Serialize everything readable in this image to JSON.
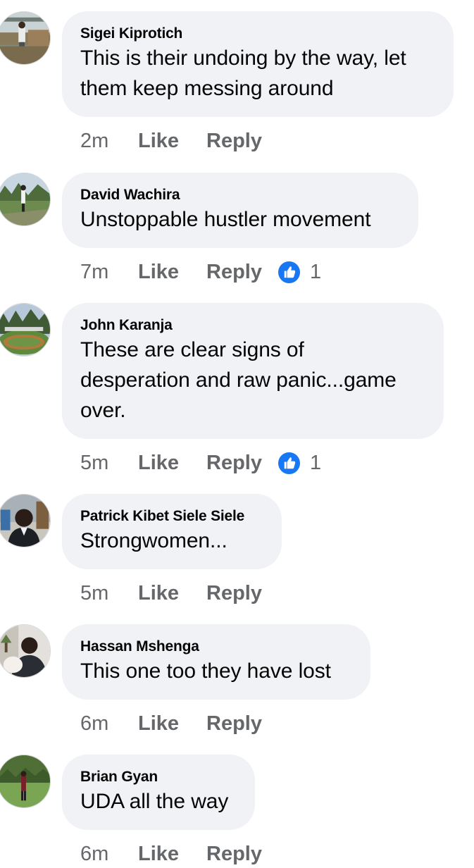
{
  "comments": [
    {
      "author": "Sigei Kiprotich",
      "lines": [
        "This is their undoing by the way, let",
        "them keep messing around"
      ],
      "time": "2m",
      "like_label": "Like",
      "reply_label": "Reply",
      "reactions": null
    },
    {
      "author": "David Wachira",
      "lines": [
        "Unstoppable hustler movement"
      ],
      "time": "7m",
      "like_label": "Like",
      "reply_label": "Reply",
      "reactions": "1"
    },
    {
      "author": "John Karanja",
      "lines": [
        "These are clear signs of",
        "desperation and raw panic...game",
        "over."
      ],
      "time": "5m",
      "like_label": "Like",
      "reply_label": "Reply",
      "reactions": "1"
    },
    {
      "author": "Patrick Kibet Siele Siele",
      "lines": [
        "Strongwomen..."
      ],
      "time": "5m",
      "like_label": "Like",
      "reply_label": "Reply",
      "reactions": null
    },
    {
      "author": "Hassan Mshenga",
      "lines": [
        "This one too they have lost"
      ],
      "time": "6m",
      "like_label": "Like",
      "reply_label": "Reply",
      "reactions": null
    },
    {
      "author": "Brian Gyan",
      "lines": [
        "UDA all the way"
      ],
      "time": "6m",
      "like_label": "Like",
      "reply_label": "Reply",
      "reactions": null
    }
  ],
  "colors": {
    "bubble": "#f0f2f5",
    "text": "#050505",
    "meta": "#65676b",
    "like_reaction": "#1877f2"
  }
}
